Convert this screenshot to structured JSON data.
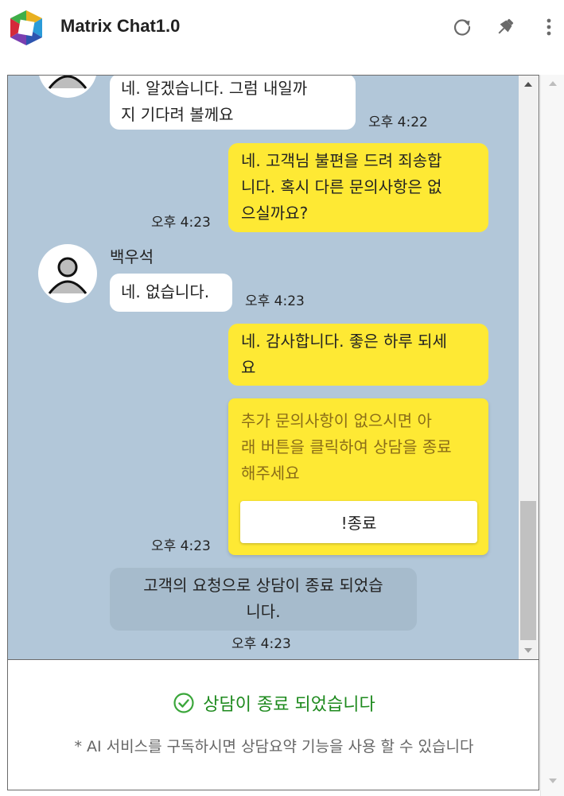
{
  "header": {
    "title": "Matrix Chat1.0",
    "icons": [
      "refresh-icon",
      "pin-icon",
      "more-vertical-icon"
    ]
  },
  "messages": [
    {
      "type": "incoming",
      "lines": [
        "네. 알겠습니다. 그럼 내일까",
        "지 기다려 볼께요"
      ],
      "time": "오후 4:22"
    },
    {
      "type": "outgoing",
      "lines": [
        "네. 고객님 불편을 드려 죄송합",
        "니다. 혹시 다른 문의사항은 없",
        "으실까요?"
      ],
      "time": "오후 4:23"
    },
    {
      "type": "incoming",
      "sender": "백우석",
      "lines": [
        "네. 없습니다."
      ],
      "time": "오후 4:23"
    },
    {
      "type": "outgoing",
      "lines": [
        "네. 감사합니다. 좋은 하루 되세",
        "요"
      ],
      "time": "오후 4:23"
    },
    {
      "type": "notice",
      "lines": [
        "추가 문의사항이 없으시면 아",
        "래 버튼을 클릭하여 상담을 종료",
        "해주세요"
      ],
      "button_label": "!종료",
      "time": "오후 4:23"
    },
    {
      "type": "system",
      "lines": [
        "고객의 요청으로 상담이 종료 되었습",
        "니다."
      ],
      "time": "오후 4:23"
    }
  ],
  "footer": {
    "status_text": "상담이 종료 되었습니다",
    "ai_note": "* AI 서비스를 구독하시면 상담요약 기능을 사용 할 수 있습니다"
  },
  "colors": {
    "chat_bg": "#b2c7d9",
    "outgoing_bubble": "#fee934",
    "incoming_bubble": "#ffffff",
    "system_bubble": "#a6bbcc",
    "status_green": "#1e8a1e"
  }
}
